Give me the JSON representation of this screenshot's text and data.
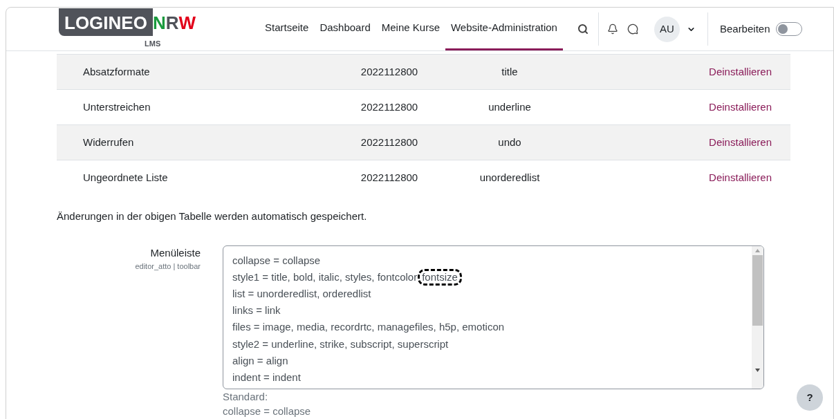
{
  "logo": {
    "text": "LOGINEO",
    "accent_1": "N",
    "accent_2": "R",
    "accent_3": "W",
    "sub": "LMS"
  },
  "nav": [
    {
      "label": "Startseite",
      "selected": false
    },
    {
      "label": "Dashboard",
      "selected": false
    },
    {
      "label": "Meine Kurse",
      "selected": false
    },
    {
      "label": "Website-Administration",
      "selected": true
    }
  ],
  "user": {
    "initials": "AU"
  },
  "edit_mode": {
    "label": "Bearbeiten",
    "on": false
  },
  "table": {
    "rows": [
      {
        "name": "Absatzformate",
        "version": "2022112800",
        "id": "title",
        "action": "Deinstallieren"
      },
      {
        "name": "Unterstreichen",
        "version": "2022112800",
        "id": "underline",
        "action": "Deinstallieren"
      },
      {
        "name": "Widerrufen",
        "version": "2022112800",
        "id": "undo",
        "action": "Deinstallieren"
      },
      {
        "name": "Ungeordnete Liste",
        "version": "2022112800",
        "id": "unorderedlist",
        "action": "Deinstallieren"
      }
    ]
  },
  "note": "Änderungen in der obigen Tabelle werden automatisch gespeichert.",
  "setting": {
    "label": "Menüleiste",
    "key": "editor_atto | toolbar",
    "lines": [
      {
        "text": "collapse = collapse"
      },
      {
        "text": "style1 = title, bold, italic, styles, fontcolor",
        "highlight": "fontsize"
      },
      {
        "text": "list = unorderedlist, orderedlist"
      },
      {
        "text": "links = link"
      },
      {
        "text": "files = image, media, recordrtc, managefiles, h5p, emoticon"
      },
      {
        "text": "style2 = underline, strike, subscript, superscript"
      },
      {
        "text": "align = align"
      },
      {
        "text": "indent = indent"
      }
    ],
    "default_label": "Standard:",
    "default_first": "collapse = collapse"
  },
  "help": "?"
}
